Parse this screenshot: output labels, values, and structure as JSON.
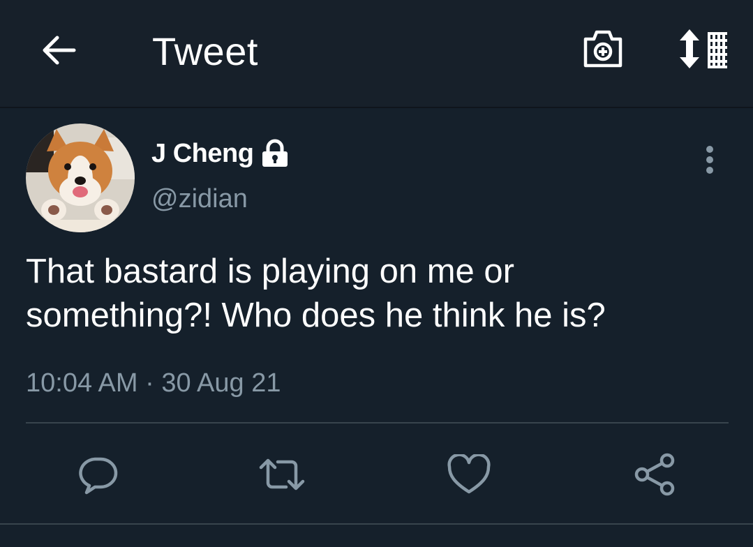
{
  "header": {
    "title": "Tweet",
    "back_icon": "arrow-left-icon",
    "camera_icon": "camera-plus-icon",
    "sort_icon": "sort-list-icon"
  },
  "tweet": {
    "display_name": "J Cheng",
    "handle": "@zidian",
    "protected": true,
    "text": "That bastard is playing on me or\nsomething?! Who does he think he is?",
    "timestamp": "10:04 AM · 30 Aug 21"
  },
  "actions": {
    "reply_icon": "reply-icon",
    "retweet_icon": "retweet-icon",
    "like_icon": "heart-icon",
    "share_icon": "share-icon"
  },
  "colors": {
    "background": "#15202b",
    "secondary_text": "#8899a6",
    "divider": "#38444d",
    "icon": "#8899a6"
  }
}
